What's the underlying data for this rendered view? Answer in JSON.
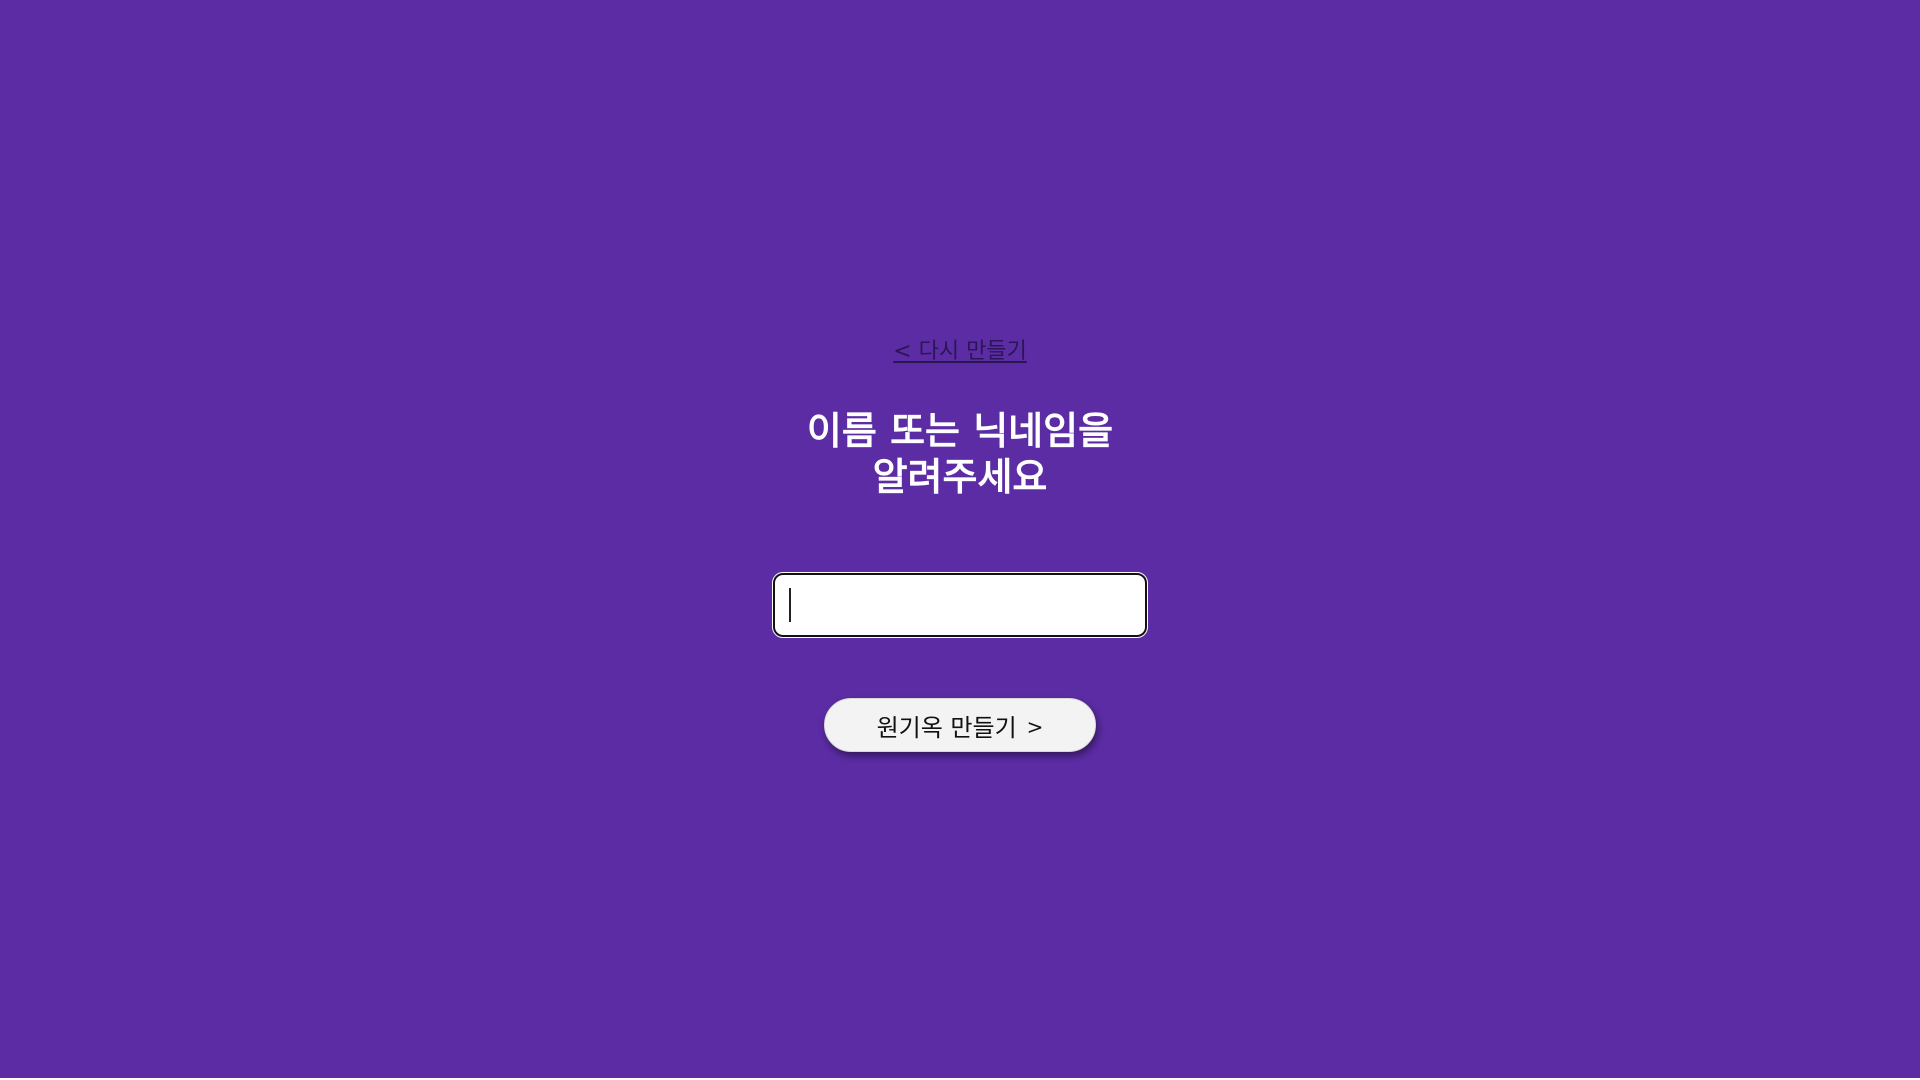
{
  "colors": {
    "background": "#5c2ca5",
    "title_text": "#ffffff",
    "link_text": "#2b1655",
    "button_bg": "#f3f3f3"
  },
  "nav": {
    "back_label": "< 다시 만들기"
  },
  "heading": {
    "line1": "이름 또는 닉네임을",
    "line2": "알려주세요"
  },
  "name_input": {
    "value": "",
    "placeholder": ""
  },
  "submit": {
    "label": "원기옥 만들기",
    "arrow": ">",
    "arrow_icon": "chevron-right-icon"
  }
}
